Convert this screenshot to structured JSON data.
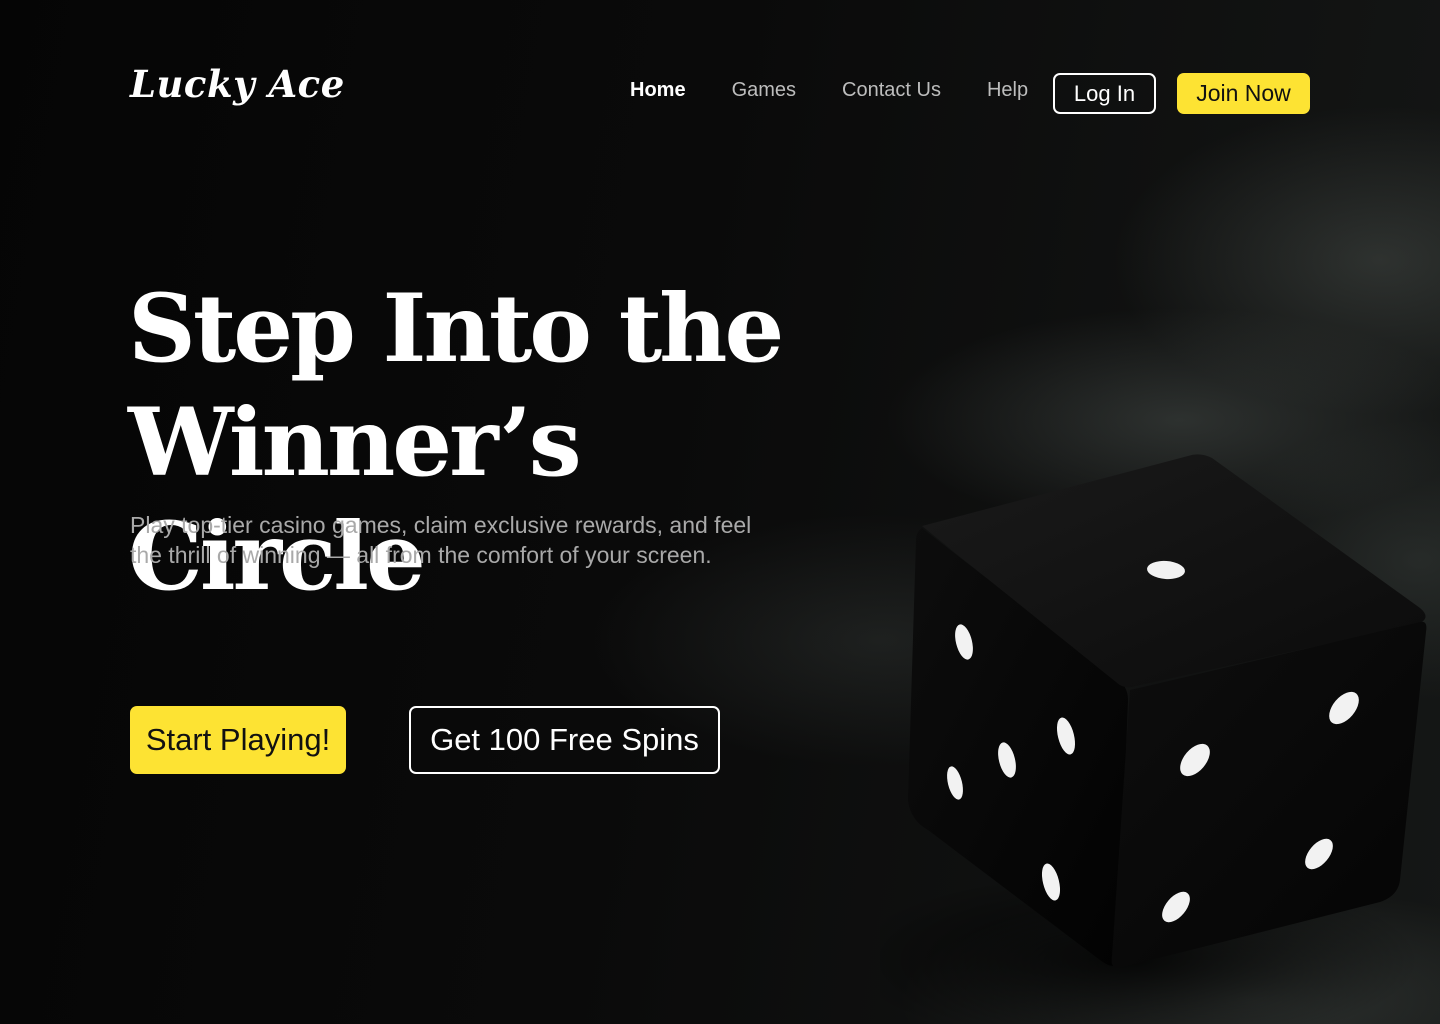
{
  "brand": {
    "name": "Lucky Ace"
  },
  "nav": {
    "items": [
      {
        "label": "Home",
        "active": true
      },
      {
        "label": "Games",
        "active": false
      },
      {
        "label": "Contact Us",
        "active": false
      },
      {
        "label": "Help",
        "active": false
      }
    ],
    "login_label": "Log In",
    "join_label": "Join Now"
  },
  "hero": {
    "title_line1": "Step Into the",
    "title_line2": "Winner’s Circle",
    "subtitle_line1": "Play top-tier casino games, claim exclusive rewards, and feel",
    "subtitle_line2": "the thrill of winning — all from the comfort of your screen.",
    "primary_cta": "Start Playing!",
    "secondary_cta": "Get 100 Free Spins"
  },
  "colors": {
    "accent": "#fde333",
    "background": "#070707",
    "muted_text": "#a9a9a9"
  },
  "illustration": {
    "name": "black-dice-icon"
  }
}
